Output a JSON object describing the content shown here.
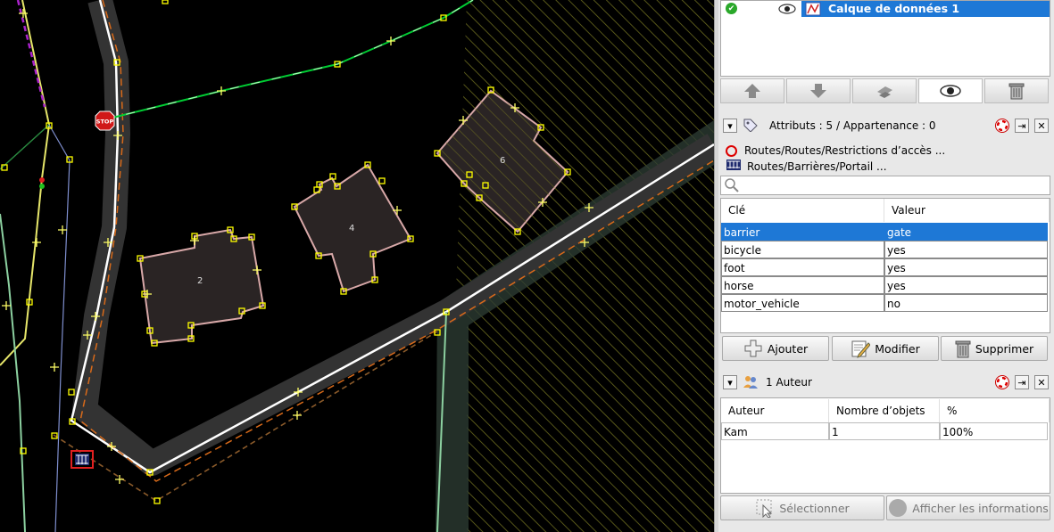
{
  "layers": {
    "active_layer_name": "Calque de données 1",
    "buttons": [
      "move-up",
      "move-down",
      "merge",
      "show-hide",
      "delete"
    ]
  },
  "attributes_panel": {
    "title": "Attributs : 5 / Appartenance : 0",
    "presets": [
      "Routes/Routes/Restrictions d’accès ...",
      "Routes/Barrières/Portail ..."
    ],
    "search_value": "",
    "headers": {
      "key": "Clé",
      "value": "Valeur"
    },
    "rows": [
      {
        "key": "barrier",
        "value": "gate"
      },
      {
        "key": "bicycle",
        "value": "yes"
      },
      {
        "key": "foot",
        "value": "yes"
      },
      {
        "key": "horse",
        "value": "yes"
      },
      {
        "key": "motor_vehicle",
        "value": "no"
      }
    ],
    "selected_row": "barrier",
    "buttons": {
      "add": "Ajouter",
      "edit": "Modifier",
      "delete": "Supprimer"
    }
  },
  "authors_panel": {
    "title": "1 Auteur",
    "headers": {
      "author": "Auteur",
      "count": "Nombre d’objets",
      "percent": "%"
    },
    "rows": [
      {
        "author": "Kam",
        "count": "1",
        "percent": "100%"
      }
    ],
    "buttons": {
      "select": "Sélectionner",
      "info": "Afficher les informations"
    }
  },
  "map": {
    "building_labels": [
      "2",
      "4",
      "6"
    ],
    "stop_sign_text": "STOP",
    "colors": {
      "road_casing": "#333333",
      "road_line": "#ffffff",
      "highlight": "#1e78d6",
      "node": "#ffff00"
    }
  }
}
